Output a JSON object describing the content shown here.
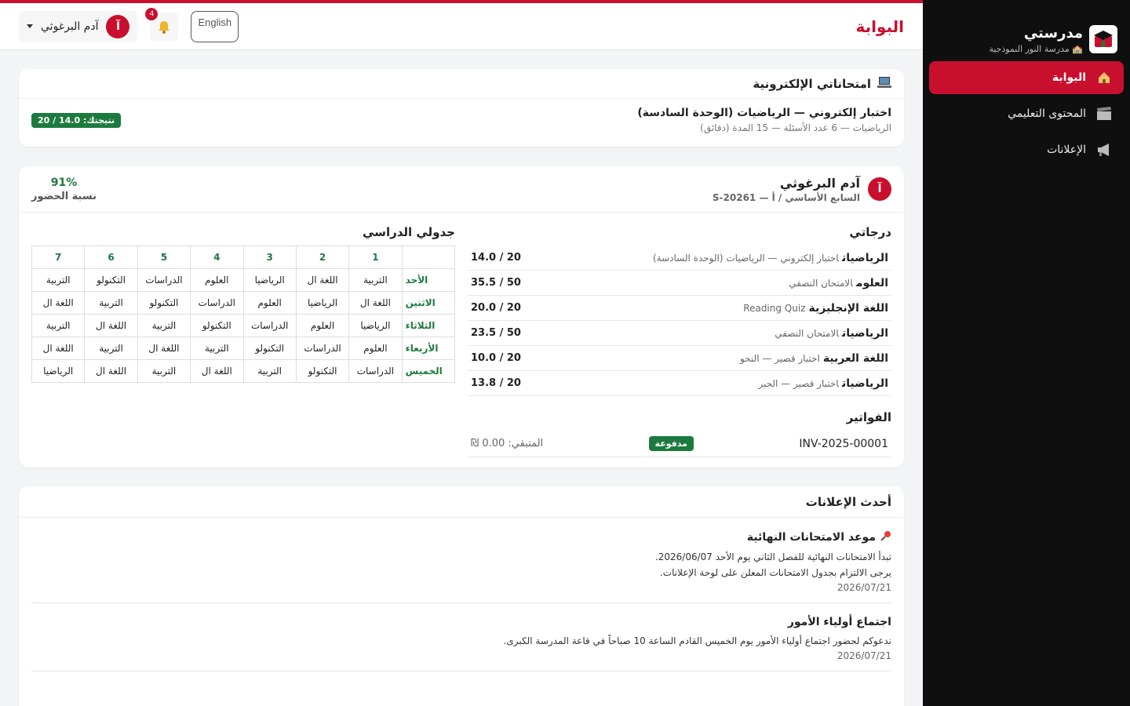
{
  "brand": {
    "title": "مدرستي",
    "subtitle": "🏫 مدرسة النور النموذجية"
  },
  "sidebar": {
    "items": [
      {
        "label": "البوابة",
        "icon": "home-icon",
        "active": true
      },
      {
        "label": "المحتوى التعليمي",
        "icon": "clapperboard-icon",
        "active": false
      },
      {
        "label": "الإعلانات",
        "icon": "megaphone-icon",
        "active": false
      }
    ]
  },
  "header": {
    "title": "البوابة",
    "user_name": "آدم البرغوثي",
    "avatar_letter": "آ",
    "notifications_count": "4",
    "language_button": "English"
  },
  "exams": {
    "title": "امتحاناتي الإلكترونية",
    "items": [
      {
        "title": "اختبار إلكتروني — الرياضيات (الوحدة السادسة)",
        "meta": "الرياضيات — 6 عدد الأسئلة — 15 المدة (دقائق)",
        "score": "نتيجتك: 14.0 / 20"
      }
    ]
  },
  "student": {
    "name": "آدم البرغوثي",
    "avatar_letter": "آ",
    "class_info": "السابع الأساسي / أ — S-20261",
    "attendance_value": "91%",
    "attendance_label": "نسبة الحضور"
  },
  "grades": {
    "title": "درجاتي",
    "rows": [
      {
        "subject": "الرياضيات",
        "exam": "اختبار إلكتروني — الرياضيات (الوحدة السادسة)",
        "score": "14.0 / 20"
      },
      {
        "subject": "العلوم",
        "exam": "الامتحان النصفي",
        "score": "35.5 / 50"
      },
      {
        "subject": "اللغة الإنجليزية",
        "exam": "Reading Quiz",
        "score": "20.0 / 20"
      },
      {
        "subject": "الرياضيات",
        "exam": "الامتحان النصفي",
        "score": "23.5 / 50"
      },
      {
        "subject": "اللغة العربية",
        "exam": "اختبار قصير — النحو",
        "score": "10.0 / 20"
      },
      {
        "subject": "الرياضيات",
        "exam": "اختبار قصير — الجبر",
        "score": "13.8 / 20"
      }
    ]
  },
  "invoices": {
    "title": "الفواتير",
    "rows": [
      {
        "id": "INV-2025-00001",
        "status": "مدفوعة",
        "remaining": "المتبقي: 0.00 ₪"
      }
    ]
  },
  "schedule": {
    "title": "جدولي الدراسي",
    "periods": [
      "1",
      "2",
      "3",
      "4",
      "5",
      "6",
      "7"
    ],
    "days": [
      {
        "day": "الأحد",
        "cells": [
          "التربية",
          "اللغة ال",
          "الرياضيا",
          "العلوم",
          "الدراسات",
          "التكنولو",
          "التربية"
        ]
      },
      {
        "day": "الاثنين",
        "cells": [
          "اللغة ال",
          "الرياضيا",
          "العلوم",
          "الدراسات",
          "التكنولو",
          "التربية",
          "اللغة ال"
        ]
      },
      {
        "day": "الثلاثاء",
        "cells": [
          "الرياضيا",
          "العلوم",
          "الدراسات",
          "التكنولو",
          "التربية",
          "اللغة ال",
          "التربية"
        ]
      },
      {
        "day": "الأربعاء",
        "cells": [
          "العلوم",
          "الدراسات",
          "التكنولو",
          "التربية",
          "اللغة ال",
          "التربية",
          "اللغة ال"
        ]
      },
      {
        "day": "الخميس",
        "cells": [
          "الدراسات",
          "التكنولو",
          "التربية",
          "اللغة ال",
          "التربية",
          "اللغة ال",
          "الرياضيا"
        ]
      }
    ]
  },
  "announcements": {
    "title": "أحدث الإعلانات",
    "items": [
      {
        "pinned": true,
        "title": "موعد الامتحانات النهائية",
        "body": [
          "تبدأ الامتحانات النهائية للفصل الثاني يوم الأحد 2026/06/07.",
          "يرجى الالتزام بجدول الامتحانات المعلن على لوحة الإعلانات."
        ],
        "date": "2026/07/21"
      },
      {
        "pinned": false,
        "title": "اجتماع أولياء الأمور",
        "body": [
          "ندعوكم لحضور اجتماع أولياء الأمور يوم الخميس القادم الساعة 10 صباحاً في قاعة المدرسة الكبرى."
        ],
        "date": "2026/07/21"
      }
    ]
  },
  "colors": {
    "accent": "#c8102e",
    "success": "#1d7a3f",
    "sidebar_bg": "#0f0f10"
  }
}
